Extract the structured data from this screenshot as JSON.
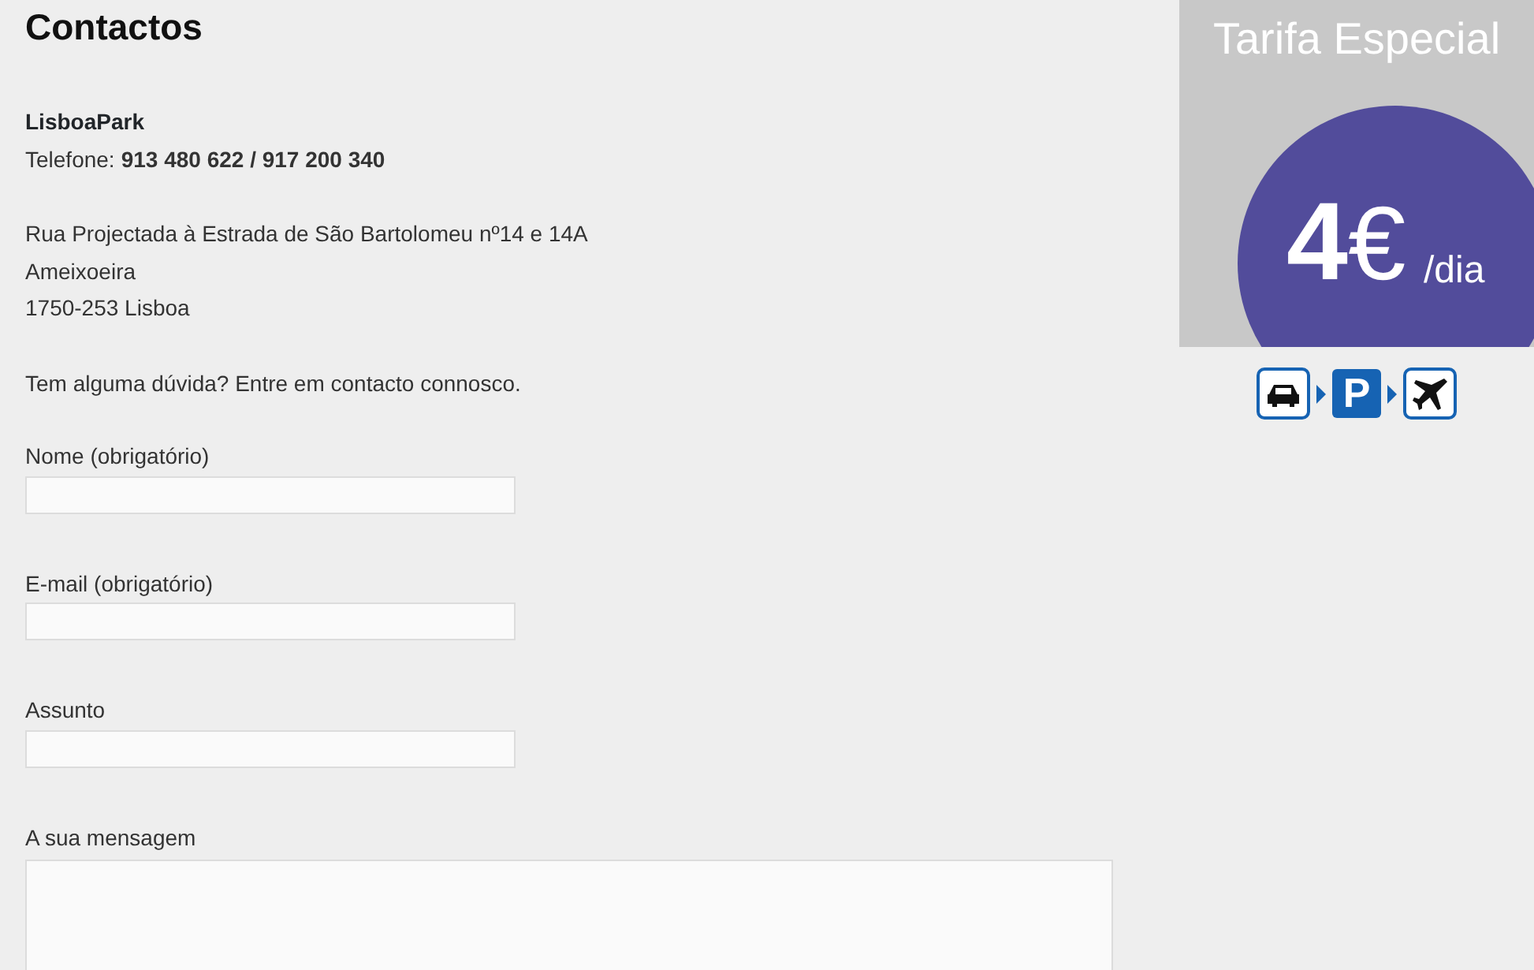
{
  "heading": "Contactos",
  "company": "LisboaPark",
  "phone_label": "Telefone:",
  "phone_numbers": "913 480 622 / 917 200 340",
  "address_lines": [
    "Rua Projectada à Estrada de São Bartolomeu nº14 e 14A",
    "Ameixoeira",
    "1750-253 Lisboa"
  ],
  "intro": "Tem alguma dúvida? Entre em contacto connosco.",
  "fields": [
    {
      "label": "Nome (obrigatório)",
      "kind": "input"
    },
    {
      "label": "E-mail (obrigatório)",
      "kind": "input"
    },
    {
      "label": "Assunto",
      "kind": "input"
    },
    {
      "label": "A sua mensagem",
      "kind": "textarea"
    }
  ],
  "promo": {
    "title": "Tarifa Especial",
    "price": "**4**€",
    "unit": "/dia",
    "parking_sign": "P"
  }
}
